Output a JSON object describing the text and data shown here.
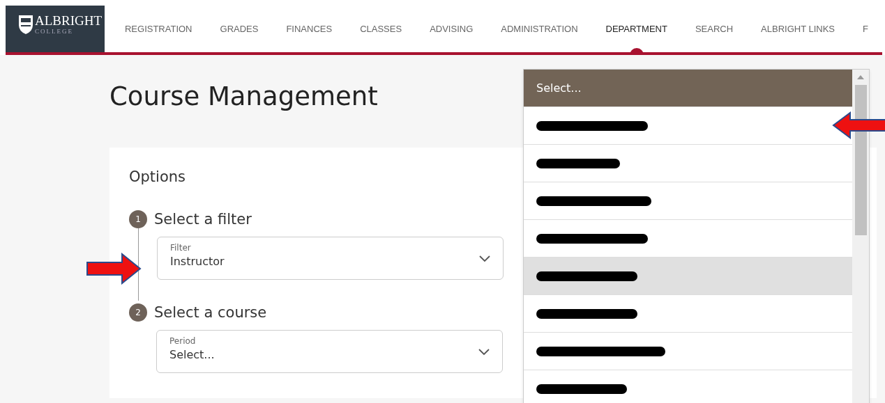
{
  "logo": {
    "name": "ALBRIGHT",
    "subtitle": "COLLEGE"
  },
  "nav": [
    {
      "label": "REGISTRATION",
      "selected": false
    },
    {
      "label": "GRADES",
      "selected": false
    },
    {
      "label": "FINANCES",
      "selected": false
    },
    {
      "label": "CLASSES",
      "selected": false
    },
    {
      "label": "ADVISING",
      "selected": false
    },
    {
      "label": "ADMINISTRATION",
      "selected": false
    },
    {
      "label": "DEPARTMENT",
      "selected": true
    },
    {
      "label": "SEARCH",
      "selected": false
    },
    {
      "label": "ALBRIGHT LINKS",
      "selected": false
    },
    {
      "label": "F",
      "selected": false
    }
  ],
  "page_title": "Course Management",
  "options": {
    "title": "Options",
    "steps": [
      {
        "number": "1",
        "title": "Select a filter",
        "field": {
          "label": "Filter",
          "value": "Instructor"
        }
      },
      {
        "number": "2",
        "title": "Select a course",
        "field": {
          "label": "Period",
          "value": "Select..."
        }
      }
    ]
  },
  "dropdown": {
    "items": [
      {
        "kind": "text",
        "label": "Select...",
        "selected": true
      },
      {
        "kind": "redacted",
        "selected": false,
        "hovered": false
      },
      {
        "kind": "redacted",
        "selected": false,
        "hovered": false
      },
      {
        "kind": "redacted",
        "selected": false,
        "hovered": false
      },
      {
        "kind": "redacted",
        "selected": false,
        "hovered": false
      },
      {
        "kind": "redacted",
        "selected": false,
        "hovered": true
      },
      {
        "kind": "redacted",
        "selected": false,
        "hovered": false
      },
      {
        "kind": "redacted",
        "selected": false,
        "hovered": false
      },
      {
        "kind": "redacted",
        "selected": false,
        "hovered": false
      }
    ]
  }
}
